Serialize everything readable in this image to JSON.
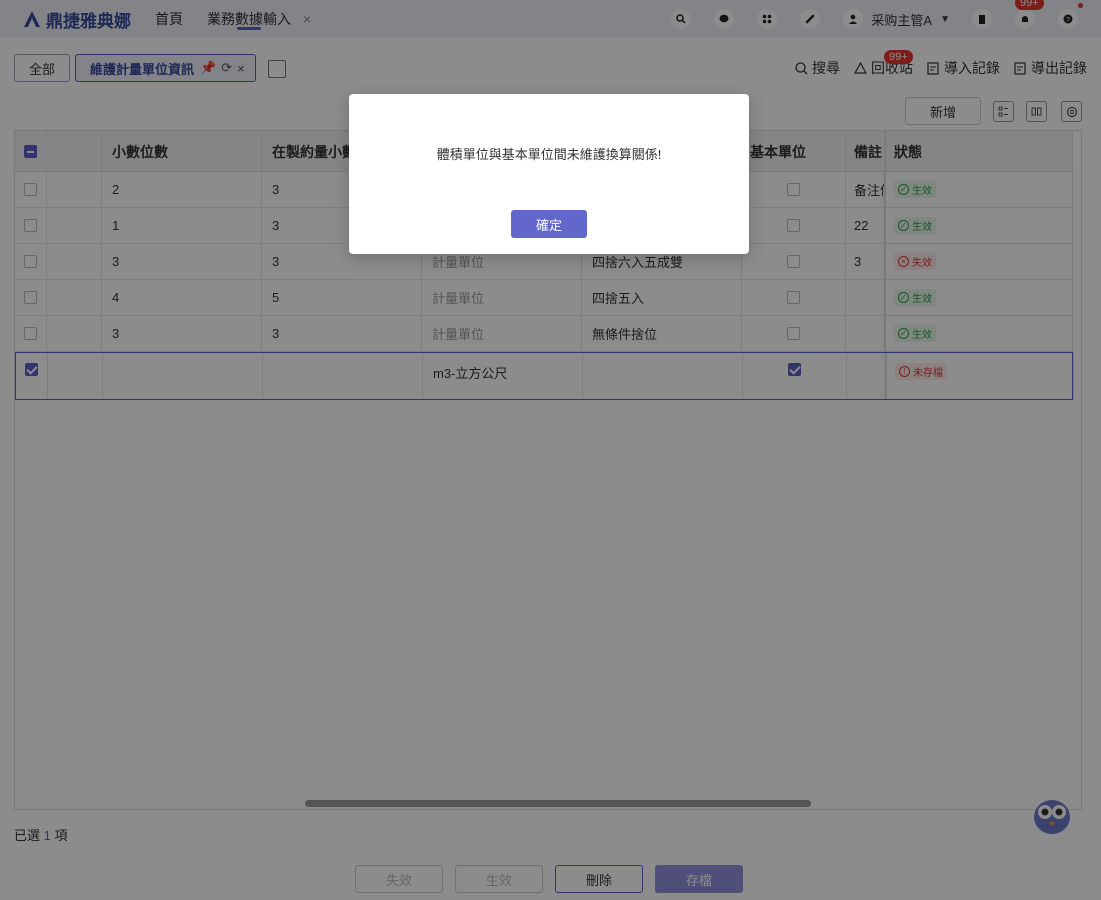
{
  "app": {
    "name": "鼎捷雅典娜"
  },
  "nav": {
    "home": "首頁",
    "active_tab": "業務數據輸入",
    "close": "×"
  },
  "user": {
    "name": "采购主管A",
    "caret": "▼"
  },
  "notifications": {
    "badge": "99+"
  },
  "tabs": {
    "all": "全部",
    "current": "維護計量單位資訊",
    "pin": "📌",
    "refresh": "⟳",
    "close": "×"
  },
  "actions": {
    "search": "搜尋",
    "recycle": "回收站",
    "recycle_badge": "99+",
    "import_log": "導入記錄",
    "export_log": "導出記錄"
  },
  "toolbar": {
    "add": "新增"
  },
  "table": {
    "headers": [
      "小數位數",
      "在製約量小數",
      "",
      "",
      "基本單位",
      "備註",
      "狀態"
    ],
    "rows": [
      {
        "decimals": "2",
        "wip_decimals": "3",
        "type": "",
        "rounding": "",
        "base": false,
        "note": "备注信",
        "status": "生效",
        "status_kind": "ok",
        "checked": false
      },
      {
        "decimals": "1",
        "wip_decimals": "3",
        "type": "",
        "rounding": "",
        "base": false,
        "note": "22",
        "status": "生效",
        "status_kind": "ok",
        "checked": false
      },
      {
        "decimals": "3",
        "wip_decimals": "3",
        "type": "計量單位",
        "rounding": "四捨六入五成雙",
        "base": false,
        "note": "3",
        "status": "失效",
        "status_kind": "bad",
        "checked": false
      },
      {
        "decimals": "4",
        "wip_decimals": "5",
        "type": "計量單位",
        "rounding": "四捨五入",
        "base": false,
        "note": "",
        "status": "生效",
        "status_kind": "ok",
        "checked": false
      },
      {
        "decimals": "3",
        "wip_decimals": "3",
        "type": "計量單位",
        "rounding": "無條件捨位",
        "base": false,
        "note": "",
        "status": "生效",
        "status_kind": "ok",
        "checked": false
      },
      {
        "decimals": "",
        "wip_decimals": "",
        "type": "m3-立方公尺",
        "rounding": "",
        "base": true,
        "note": "",
        "status": "未存檔",
        "status_kind": "bad",
        "checked": true
      }
    ]
  },
  "selection": {
    "prefix": "已選",
    "count": "1",
    "suffix": "項"
  },
  "bottom": {
    "disable": "失效",
    "enable": "生效",
    "delete": "刪除",
    "save": "存檔"
  },
  "modal": {
    "message": "體積單位與基本單位間未維護換算關係!",
    "ok": "確定"
  },
  "colors": {
    "accent": "#5b5fc7",
    "ok": "#2e9e4f",
    "bad": "#d9363e"
  }
}
